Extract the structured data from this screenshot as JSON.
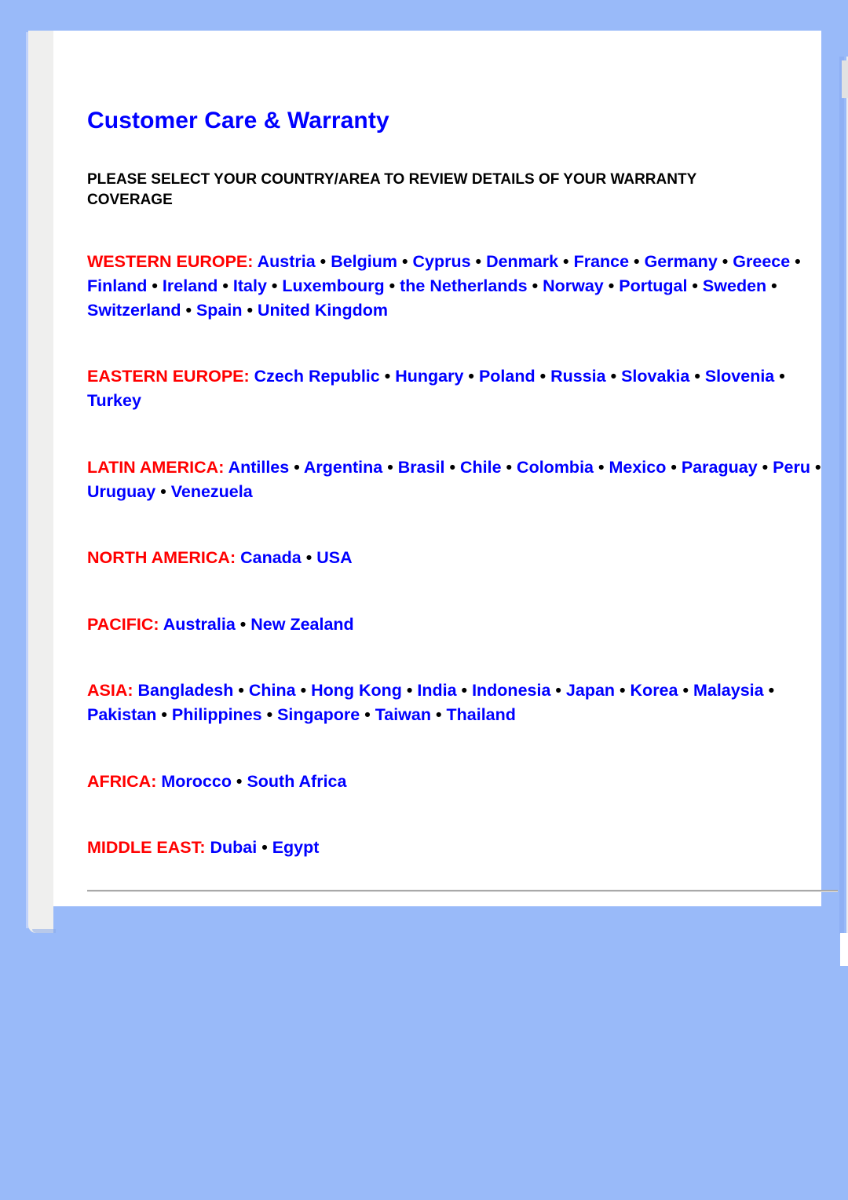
{
  "page": {
    "title": "Customer Care & Warranty",
    "instruction": "PLEASE SELECT YOUR COUNTRY/AREA TO REVIEW DETAILS OF YOUR WARRANTY COVERAGE",
    "separator": "•",
    "colors": {
      "background": "#99baf9",
      "sheet": "#ffffff",
      "gutter": "#efefee",
      "title": "#0000ff",
      "region_label": "#ff0000",
      "country_link": "#0000ff",
      "instruction_text": "#000000",
      "divider": "#a9a9a9"
    }
  },
  "regions": [
    {
      "label": "WESTERN EUROPE:",
      "countries": [
        "Austria",
        "Belgium",
        "Cyprus",
        "Denmark",
        "France",
        "Germany",
        "Greece",
        "Finland",
        "Ireland",
        "Italy",
        "Luxembourg",
        "the Netherlands",
        "Norway",
        "Portugal",
        "Sweden",
        "Switzerland",
        "Spain",
        "United Kingdom"
      ]
    },
    {
      "label": "EASTERN EUROPE:",
      "countries": [
        "Czech Republic",
        "Hungary",
        "Poland",
        "Russia",
        "Slovakia",
        "Slovenia",
        "Turkey"
      ]
    },
    {
      "label": "LATIN AMERICA:",
      "countries": [
        "Antilles",
        "Argentina",
        "Brasil",
        "Chile",
        "Colombia",
        "Mexico",
        "Paraguay",
        "Peru",
        "Uruguay",
        "Venezuela"
      ]
    },
    {
      "label": "NORTH AMERICA:",
      "countries": [
        "Canada",
        "USA"
      ]
    },
    {
      "label": "PACIFIC:",
      "countries": [
        "Australia",
        "New Zealand"
      ]
    },
    {
      "label": "ASIA:",
      "countries": [
        "Bangladesh",
        "China",
        "Hong Kong",
        "India",
        "Indonesia",
        "Japan",
        "Korea",
        "Malaysia",
        "Pakistan",
        "Philippines",
        "Singapore",
        "Taiwan",
        "Thailand"
      ]
    },
    {
      "label": "AFRICA:",
      "countries": [
        "Morocco",
        "South Africa"
      ]
    },
    {
      "label": "MIDDLE EAST:",
      "countries": [
        "Dubai",
        "Egypt"
      ]
    }
  ]
}
